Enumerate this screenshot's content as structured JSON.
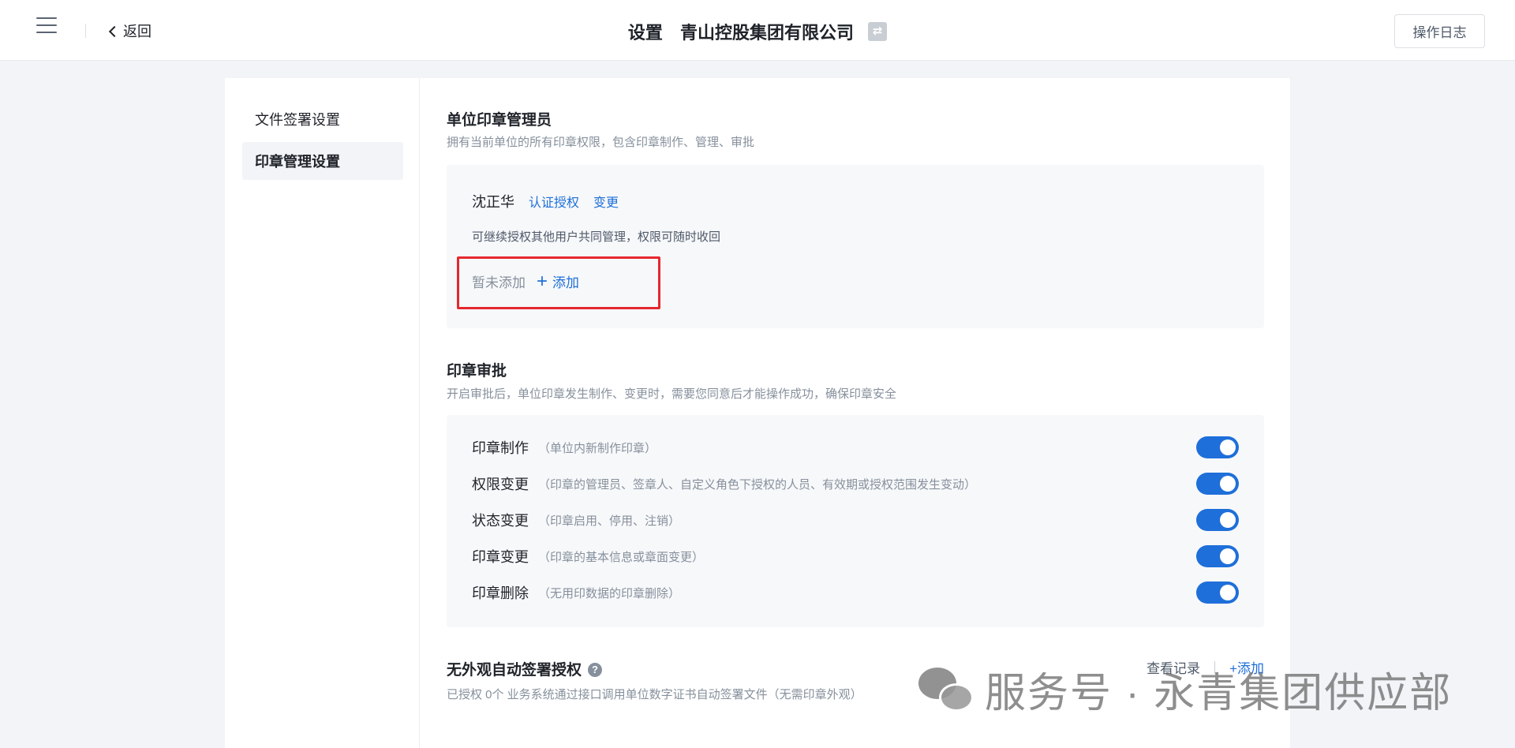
{
  "header": {
    "back_label": "返回",
    "page_title": "设置",
    "company_name": "青山控股集团有限公司",
    "log_button": "操作日志"
  },
  "sidebar": {
    "items": [
      {
        "label": "文件签署设置",
        "active": false
      },
      {
        "label": "印章管理设置",
        "active": true
      }
    ]
  },
  "admin_section": {
    "title": "单位印章管理员",
    "desc": "拥有当前单位的所有印章权限，包含印章制作、管理、审批",
    "admin_name": "沈正华",
    "auth_link": "认证授权",
    "change_link": "变更",
    "hint": "可继续授权其他用户共同管理，权限可随时收回",
    "pending_text": "暂未添加",
    "add_label": "添加"
  },
  "approval_section": {
    "title": "印章审批",
    "desc": "开启审批后，单位印章发生制作、变更时，需要您同意后才能操作成功，确保印章安全",
    "items": [
      {
        "label": "印章制作",
        "desc": "（单位内新制作印章）",
        "enabled": true
      },
      {
        "label": "权限变更",
        "desc": "（印章的管理员、签章人、自定义角色下授权的人员、有效期或授权范围发生变动）",
        "enabled": true
      },
      {
        "label": "状态变更",
        "desc": "（印章启用、停用、注销）",
        "enabled": true
      },
      {
        "label": "印章变更",
        "desc": "（印章的基本信息或章面变更）",
        "enabled": true
      },
      {
        "label": "印章删除",
        "desc": "（无用印数据的印章删除）",
        "enabled": true
      }
    ]
  },
  "auto_sign_section": {
    "title": "无外观自动签署授权",
    "help": "?",
    "desc": "已授权 0个 业务系统通过接口调用单位数字证书自动签署文件（无需印章外观）",
    "view_log": "查看记录",
    "add_label": "+添加"
  },
  "watermark": {
    "text": "服务号 · 永青集团供应部"
  },
  "colors": {
    "primary": "#1e6fd9",
    "highlight": "#e5282e",
    "background": "#f2f4f7"
  }
}
